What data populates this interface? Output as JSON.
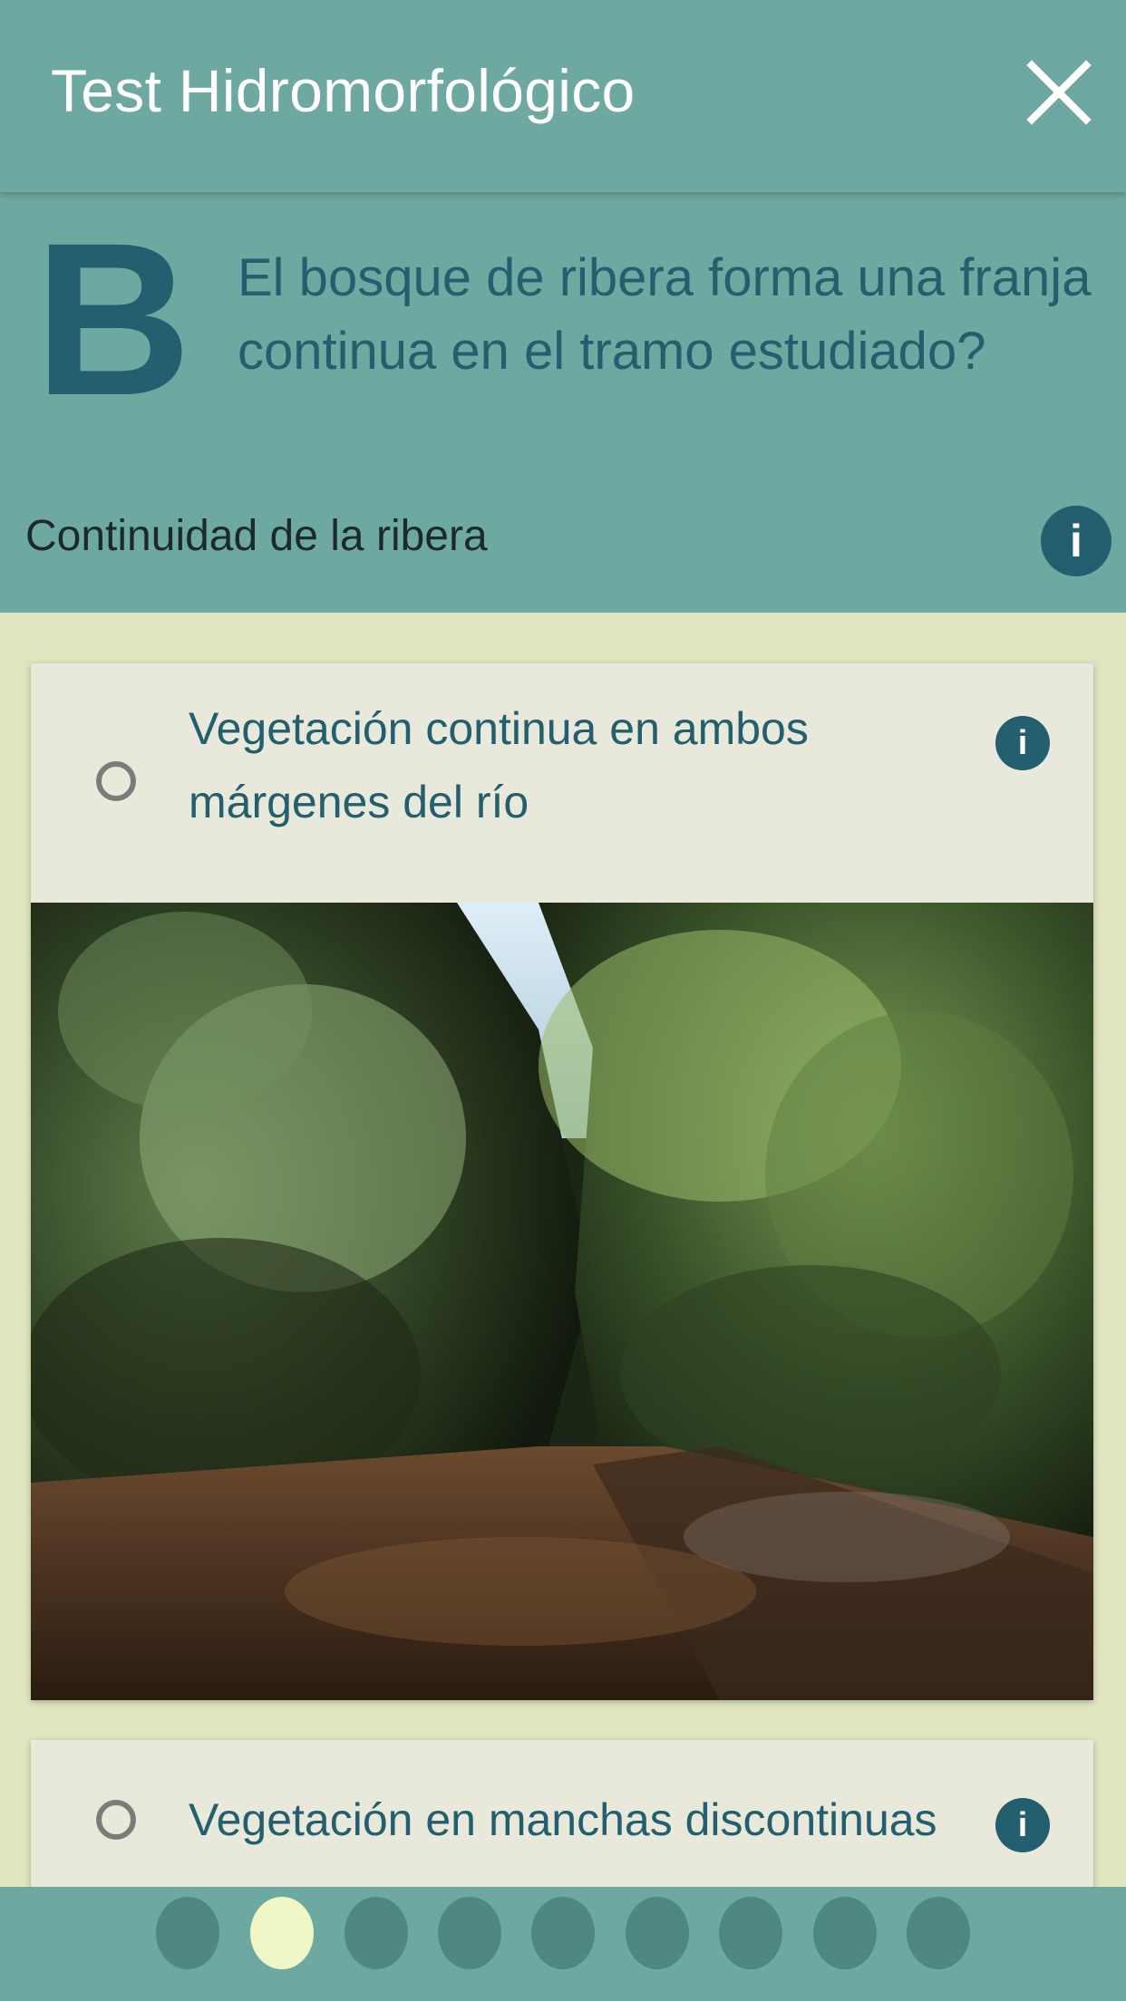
{
  "appbar": {
    "title": "Test Hidromorfológico",
    "close_icon": "close-icon"
  },
  "question": {
    "letter": "B",
    "text": "El bosque de ribera forma una franja continua en el tramo estudiado?",
    "subtitle": "Continuidad de la ribera",
    "info_icon": "info-icon"
  },
  "options": [
    {
      "label": "Vegetación continua en ambos márgenes del río",
      "selected": false,
      "image": "riparian-forest-photo"
    },
    {
      "label": "Vegetación en manchas discontinuas",
      "selected": false
    }
  ],
  "pagination": {
    "total": 9,
    "current": 2
  },
  "colors": {
    "primary": "#6ea9a1",
    "accent": "#235f6e",
    "background": "#e1e5bf",
    "card": "#e8e9da",
    "dot_inactive": "#4f8782",
    "dot_active": "#f0f7c7"
  }
}
